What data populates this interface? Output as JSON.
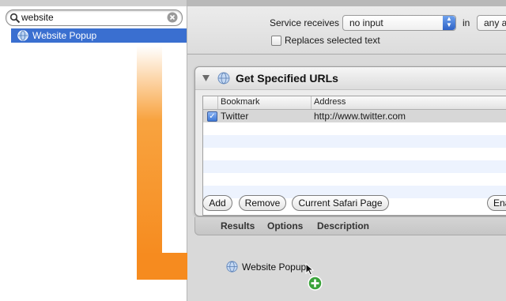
{
  "search": {
    "value": "website"
  },
  "results": [
    {
      "label": "Website Popup",
      "icon": "automator-globe-icon"
    }
  ],
  "service_bar": {
    "receives_label": "Service receives",
    "input_value": "no input",
    "in_label": "in",
    "app_value": "any ap",
    "replaces_label": "Replaces selected text",
    "replaces_checked": false
  },
  "action": {
    "title": "Get Specified URLs",
    "columns": [
      "Bookmark",
      "Address"
    ],
    "rows": [
      {
        "checked": true,
        "bookmark": "Twitter",
        "address": "http://www.twitter.com"
      }
    ],
    "buttons": {
      "add": "Add",
      "remove": "Remove",
      "current_safari": "Current Safari Page",
      "enable": "Ena"
    },
    "footer_tabs": [
      "Results",
      "Options",
      "Description"
    ]
  },
  "drag": {
    "label": "Website Popup"
  },
  "colors": {
    "selection": "#3a6fd0",
    "arrow": "#f7931e",
    "add_badge": "#3aa33a"
  }
}
